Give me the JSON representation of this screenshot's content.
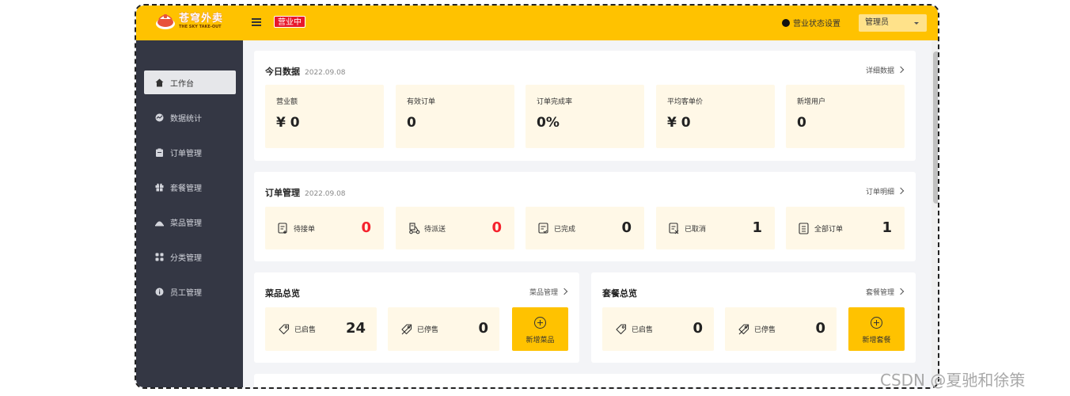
{
  "brand": {
    "title": "苍穹外卖",
    "subtitle": "THE SKY TAKE-OUT"
  },
  "header": {
    "status_badge": "营业中",
    "status_setting": "营业状态设置",
    "user_menu": "管理员"
  },
  "sidebar": {
    "items": [
      {
        "label": "工作台",
        "icon": "home-icon",
        "active": true
      },
      {
        "label": "数据统计",
        "icon": "chart-icon",
        "active": false
      },
      {
        "label": "订单管理",
        "icon": "clipboard-icon",
        "active": false
      },
      {
        "label": "套餐管理",
        "icon": "gift-icon",
        "active": false
      },
      {
        "label": "菜品管理",
        "icon": "dish-icon",
        "active": false
      },
      {
        "label": "分类管理",
        "icon": "grid-icon",
        "active": false
      },
      {
        "label": "员工管理",
        "icon": "info-icon",
        "active": false
      }
    ]
  },
  "today": {
    "title": "今日数据",
    "date": "2022.09.08",
    "link": "详细数据",
    "stats": [
      {
        "label": "营业额",
        "value": "¥ 0"
      },
      {
        "label": "有效订单",
        "value": "0"
      },
      {
        "label": "订单完成率",
        "value": "0%"
      },
      {
        "label": "平均客单价",
        "value": "¥ 0"
      },
      {
        "label": "新增用户",
        "value": "0"
      }
    ]
  },
  "orders": {
    "title": "订单管理",
    "date": "2022.09.08",
    "link": "订单明细",
    "items": [
      {
        "label": "待接单",
        "value": "0",
        "highlight": true,
        "icon": "order-pending-icon"
      },
      {
        "label": "待派送",
        "value": "0",
        "highlight": true,
        "icon": "delivery-icon"
      },
      {
        "label": "已完成",
        "value": "0",
        "highlight": false,
        "icon": "order-done-icon"
      },
      {
        "label": "已取消",
        "value": "1",
        "highlight": false,
        "icon": "order-cancel-icon"
      },
      {
        "label": "全部订单",
        "value": "1",
        "highlight": false,
        "icon": "order-all-icon"
      }
    ]
  },
  "dishes": {
    "title": "菜品总览",
    "link": "菜品管理",
    "on_sale": {
      "label": "已启售",
      "value": "24"
    },
    "off_sale": {
      "label": "已停售",
      "value": "0"
    },
    "add": "新增菜品"
  },
  "setmeals": {
    "title": "套餐总览",
    "link": "套餐管理",
    "on_sale": {
      "label": "已启售",
      "value": "0"
    },
    "off_sale": {
      "label": "已停售",
      "value": "0"
    },
    "add": "新增套餐"
  },
  "watermark": "CSDN @夏驰和徐策",
  "colors": {
    "accent": "#ffc200",
    "sidebar": "#343744",
    "tile": "#fff8e7",
    "danger": "#f5222d"
  }
}
